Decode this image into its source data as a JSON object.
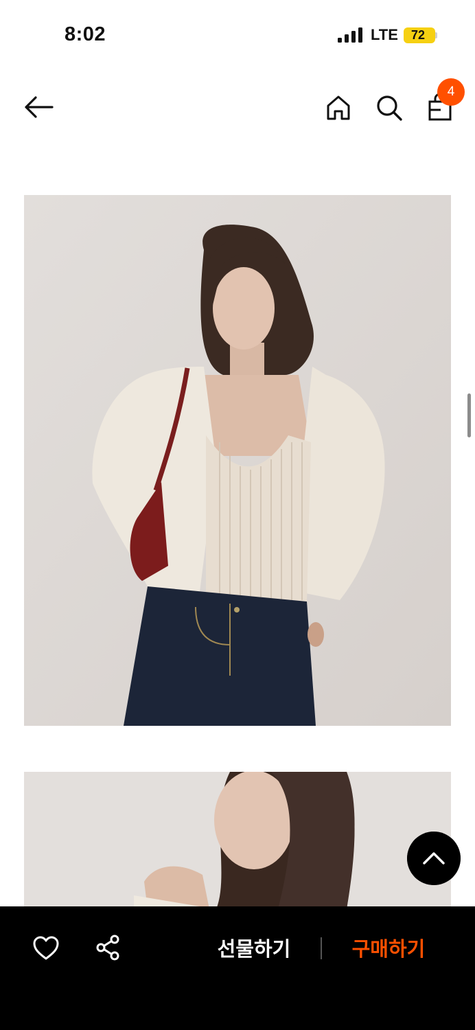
{
  "status_bar": {
    "time": "8:02",
    "network": "LTE",
    "battery": "72"
  },
  "nav": {
    "cart_count": "4",
    "icons": [
      "arrow-left-icon",
      "home-icon",
      "search-icon",
      "shopping-bag-icon"
    ]
  },
  "gallery": {
    "images": [
      "model-cream-cardigan-front",
      "model-cream-cardigan-closeup"
    ]
  },
  "bottom_bar": {
    "gift_label": "선물하기",
    "buy_label": "구매하기",
    "icons": [
      "heart-icon",
      "share-icon"
    ]
  },
  "colors": {
    "accent": "#ff5000",
    "battery": "#f6d012",
    "bar_background": "#000000"
  }
}
